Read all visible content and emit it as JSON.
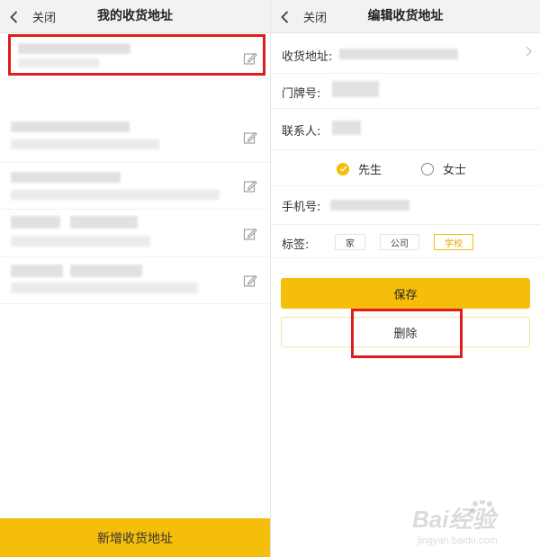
{
  "colors": {
    "accent": "#f5be0b",
    "highlight": "#e01c1c"
  },
  "list_screen": {
    "back_icon": "chevron-left-icon",
    "close_label": "关闭",
    "title": "我的收货地址",
    "edit_icon": "edit-icon",
    "add_button_label": "新增收货地址"
  },
  "edit_screen": {
    "back_icon": "chevron-left-icon",
    "close_label": "关闭",
    "title": "编辑收货地址",
    "address_label": "收货地址:",
    "door_label": "门牌号:",
    "contact_label": "联系人:",
    "gender_options": [
      "先生",
      "女士"
    ],
    "gender_selected": "先生",
    "phone_label": "手机号:",
    "tags_label": "标签:",
    "tags": [
      "家",
      "公司",
      "学校"
    ],
    "tag_selected": "学校",
    "save_label": "保存",
    "delete_label": "删除"
  },
  "watermark": {
    "brand": "Bai经验",
    "url": "jingyan.baidu.com"
  }
}
